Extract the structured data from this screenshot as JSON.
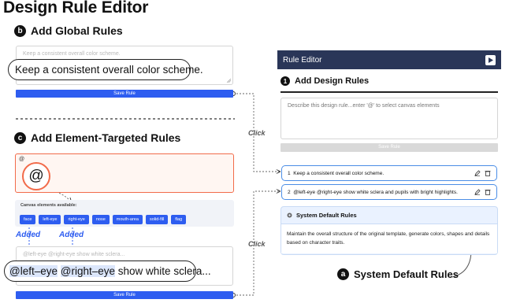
{
  "title": "Design Rule Editor",
  "global_section": {
    "badge": "b",
    "heading": "Add Global Rules",
    "placeholder": "Keep a consistent overall color scheme.",
    "callout": "Keep a consistent overall color scheme.",
    "save_label": "Save Rule"
  },
  "element_section": {
    "badge": "c",
    "heading": "Add Element-Targeted Rules",
    "input_value": "@",
    "at_symbol": "@",
    "canvas_label": "Canvas elements available:",
    "chips": [
      "face",
      "left-eye",
      "right-eye",
      "nose",
      "mouth-area",
      "solid-fill",
      "flag"
    ],
    "added_1": "Added",
    "added_2": "Added",
    "placeholder": "@left-eye @right-eye show white sclera...",
    "callout_tag_1": "@left–eye",
    "callout_tag_2": "@right–eye",
    "callout_text": "show white sclera...",
    "save_label": "Save Rule"
  },
  "click_labels": [
    "Click",
    "Click"
  ],
  "editor": {
    "header": "Rule Editor",
    "badge": "1",
    "heading": "Add Design Rules",
    "textarea_placeholder": "Describe this design rule...enter '@' to select canvas elements",
    "save_label": "Save Rule",
    "rules": [
      {
        "index": "1",
        "text": "Keep a consistent overall color scheme."
      },
      {
        "index": "2",
        "text": "@left-eye @right-eye show white sclera and pupils with bright highlights."
      }
    ],
    "system": {
      "heading": "System Default Rules",
      "body": "Maintain the overall structure of the original template, generate colors, shapes and details based on character traits."
    }
  },
  "system_caption": {
    "badge": "a",
    "text": "System Default Rules"
  },
  "colors": {
    "accent": "#2e5df0",
    "panel_header": "#2a3658",
    "rule_border": "#4a8de6",
    "highlight_box": "#f26b4a"
  }
}
